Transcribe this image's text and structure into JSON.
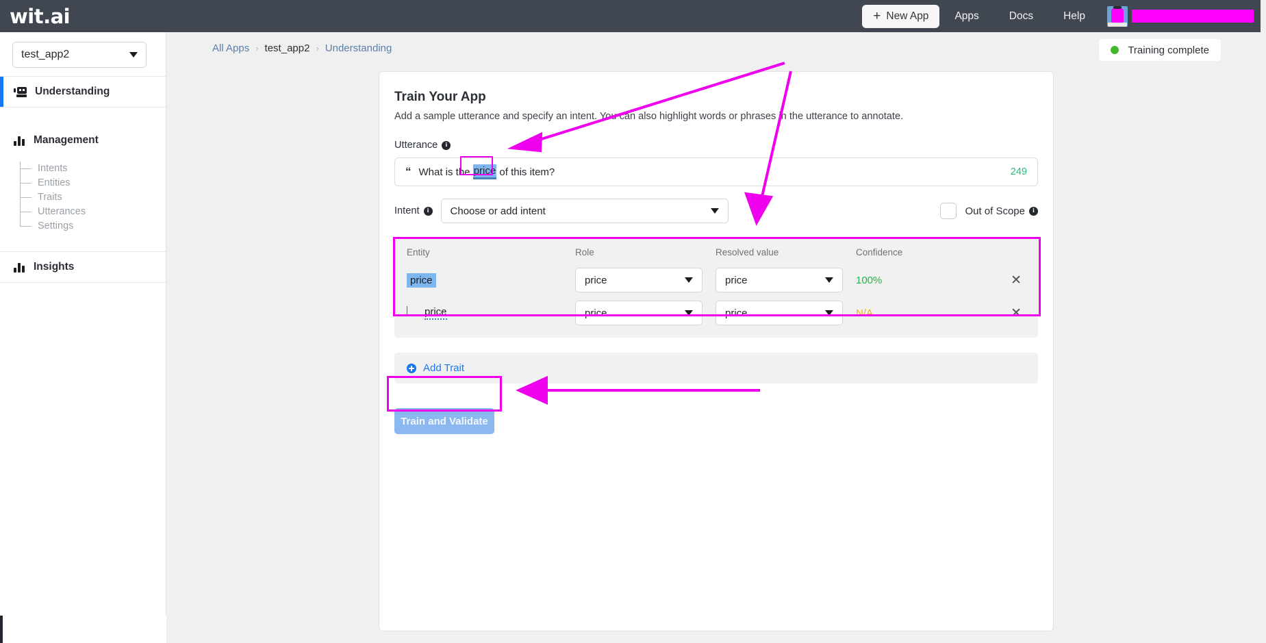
{
  "topbar": {
    "logo": "wit.ai",
    "new_app_button": "New App",
    "new_app_plus": "+",
    "links": [
      "Apps",
      "Docs",
      "Help"
    ],
    "avatar_icon": "user-avatar",
    "username_redacted": ""
  },
  "sidebar": {
    "app_selector": {
      "value": "test_app2",
      "caret_icon": "chevron-down-icon"
    },
    "understanding": {
      "label": "Understanding",
      "icon": "robot-icon",
      "active": true
    },
    "management": {
      "label": "Management",
      "icon": "bar-chart-icon"
    },
    "management_items": [
      "Intents",
      "Entities",
      "Traits",
      "Utterances",
      "Settings"
    ],
    "insights": {
      "label": "Insights",
      "icon": "bar-chart-icon"
    }
  },
  "breadcrumb": {
    "all_apps": "All Apps",
    "app": "test_app2",
    "page": "Understanding",
    "separator": "›"
  },
  "status": {
    "label": "Training complete",
    "dot_color": "#42b72a"
  },
  "card": {
    "title": "Train Your App",
    "subtitle": "Add a sample utterance and specify an intent. You can also highlight words or phrases in the utterance to annotate.",
    "utterance": {
      "label": "Utterance",
      "info_icon": "info-icon",
      "quote_icon": "quote-icon",
      "text_before": "What is the ",
      "highlight": "price",
      "text_after": " of this item?",
      "char_count": "249"
    },
    "intent": {
      "label": "Intent",
      "info_icon": "info-icon",
      "value": "Choose or add intent",
      "caret_icon": "chevron-down-icon"
    },
    "out_of_scope": {
      "label": "Out of Scope",
      "info_icon": "info-icon",
      "checked": false
    },
    "entity_table": {
      "headers": [
        "Entity",
        "Role",
        "Resolved value",
        "Confidence"
      ],
      "rows": [
        {
          "entity": "price",
          "entity_style": "chip",
          "role": "price",
          "resolved_value": "price",
          "confidence": "100%",
          "confidence_color": "#25b14b",
          "remove_icon": "close-icon"
        },
        {
          "entity": "price",
          "entity_style": "child",
          "role": "price",
          "resolved_value": "price",
          "confidence": "N/A",
          "confidence_color": "#f0ad1f",
          "remove_icon": "close-icon"
        }
      ]
    },
    "add_trait": {
      "label": "Add Trait",
      "icon": "plus-circle-icon"
    },
    "train_button": {
      "label": "Train and Validate",
      "disabled": true
    }
  },
  "annotations": {
    "highlight_color": "#ee00ee",
    "arrow_count": 3
  }
}
